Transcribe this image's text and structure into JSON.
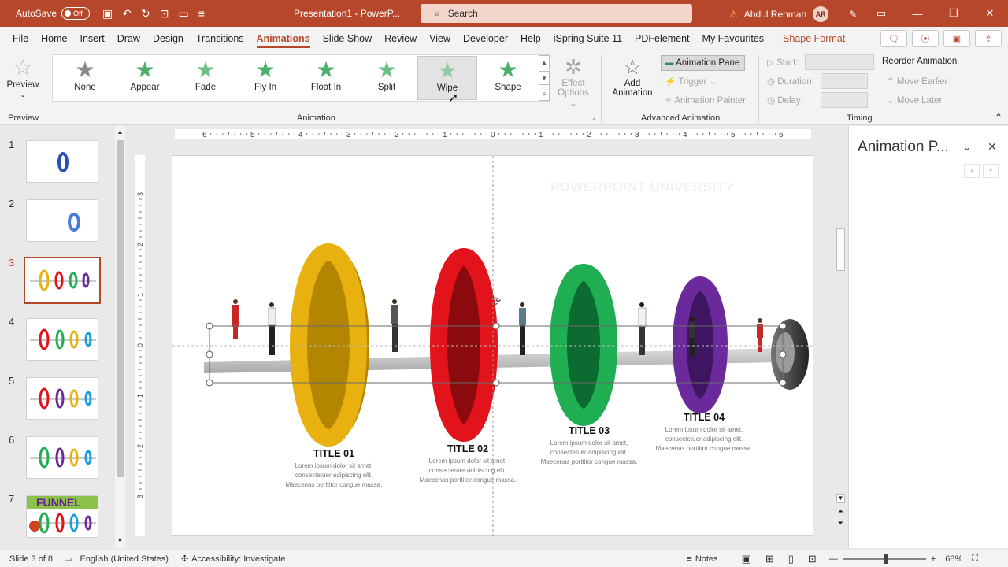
{
  "titlebar": {
    "autosave_label": "AutoSave",
    "autosave_state": "Off",
    "doc_title": "Presentation1 - PowerP...",
    "search_placeholder": "Search",
    "user_name": "Abdul Rehman",
    "user_initials": "AR",
    "brand_color": "#b7472a"
  },
  "menu": {
    "tabs": [
      "File",
      "Home",
      "Insert",
      "Draw",
      "Design",
      "Transitions",
      "Animations",
      "Slide Show",
      "Review",
      "View",
      "Developer",
      "Help",
      "iSpring Suite 11",
      "PDFelement",
      "My Favourites",
      "Shape Format"
    ],
    "active": "Animations"
  },
  "ribbon": {
    "preview_label": "Preview",
    "preview_group": "Preview",
    "animation_group": "Animation",
    "animations": [
      {
        "label": "None",
        "color": "#8a8a8a"
      },
      {
        "label": "Appear",
        "color": "#4caf6a"
      },
      {
        "label": "Fade",
        "color": "#6dbf86"
      },
      {
        "label": "Fly In",
        "color": "#4caf6a"
      },
      {
        "label": "Float In",
        "color": "#4caf6a"
      },
      {
        "label": "Split",
        "color": "#6dbf86"
      },
      {
        "label": "Wipe",
        "color": "#8fcca1"
      },
      {
        "label": "Shape",
        "color": "#4caf6a"
      }
    ],
    "selected_animation": "Wipe",
    "effect_options": "Effect Options",
    "add_animation": "Add Animation",
    "animation_pane": "Animation Pane",
    "trigger": "Trigger",
    "animation_painter": "Animation Painter",
    "advanced_group": "Advanced Animation",
    "start": "Start:",
    "duration": "Duration:",
    "delay": "Delay:",
    "timing_group": "Timing",
    "reorder": "Reorder Animation",
    "move_earlier": "Move Earlier",
    "move_later": "Move Later"
  },
  "thumbnails": [
    {
      "num": "1"
    },
    {
      "num": "2"
    },
    {
      "num": "3"
    },
    {
      "num": "4"
    },
    {
      "num": "5"
    },
    {
      "num": "6"
    },
    {
      "num": "7",
      "text": "FUNNEL"
    }
  ],
  "slide": {
    "watermark": "POWERPOINT UNIVERSITY",
    "items": [
      {
        "title": "TITLE 01",
        "body": "Lorem ipsum dolor sit amet, consectetuer adipiscing elit. Maecenas porttitor congue massa.",
        "color": "#e8b10f"
      },
      {
        "title": "TITLE 02",
        "body": "Lorem ipsum dolor sit amet, consectetuer adipiscing elit. Maecenas porttitor congue massa.",
        "color": "#e3131b"
      },
      {
        "title": "TITLE 03",
        "body": "Lorem ipsum dolor sit amet, consectetuer adipiscing elit. Maecenas porttitor congue massa.",
        "color": "#1fae52"
      },
      {
        "title": "TITLE 04",
        "body": "Lorem ipsum dolor sit amet, consectetuer adipiscing elit. Maecenas porttitor congue massa.",
        "color": "#6a2a9b"
      }
    ]
  },
  "ruler": {
    "h_ticks": [
      "6",
      "5",
      "4",
      "3",
      "2",
      "1",
      "0",
      "1",
      "2",
      "3",
      "4",
      "5",
      "6"
    ],
    "v_ticks": [
      "3",
      "2",
      "1",
      "0",
      "1",
      "2",
      "3"
    ]
  },
  "pane": {
    "title": "Animation P..."
  },
  "status": {
    "slide_info": "Slide 3 of 8",
    "language": "English (United States)",
    "accessibility": "Accessibility: Investigate",
    "notes": "Notes",
    "zoom": "68%"
  }
}
